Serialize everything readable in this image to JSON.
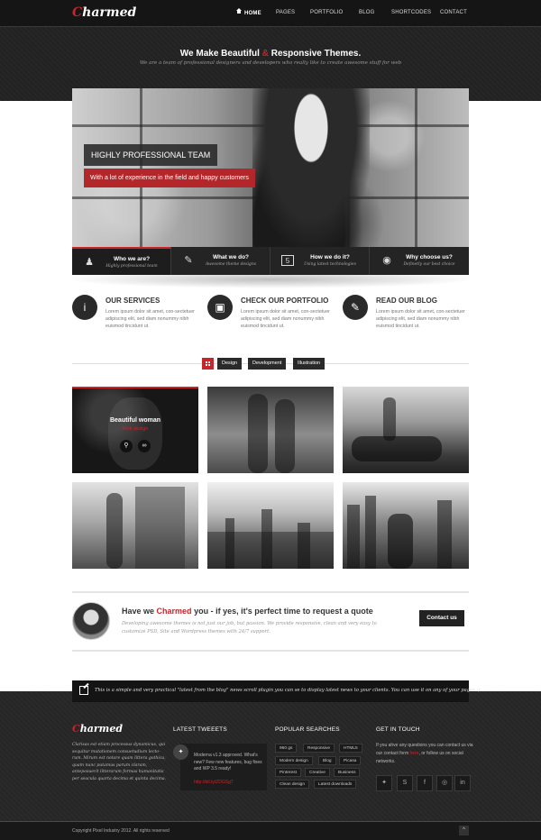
{
  "brand": {
    "logo_first": "C",
    "logo_rest": "harmed",
    "accent": "#c8242b"
  },
  "nav": {
    "items": [
      {
        "label": "HOME",
        "active": true,
        "icon": "home-icon"
      },
      {
        "label": "PAGES"
      },
      {
        "label": "PORTFOLIO"
      },
      {
        "label": "BLOG"
      },
      {
        "label": "SHORTCODES"
      },
      {
        "label": "CONTACT"
      }
    ]
  },
  "intro": {
    "headline_1": "We Make Beautiful",
    "headline_amp": "&",
    "headline_2": "Responsive Themes.",
    "subline": "We are a team of professional designers and developers who really like to create awesome stuff for web"
  },
  "slider": {
    "title": "HIGHLY PROFESSIONAL TEAM",
    "subtitle": "With a lot of experience in the field and happy customers",
    "tabs": [
      {
        "title": "Who we are?",
        "sub": "Highly professional team",
        "icon": "team-icon"
      },
      {
        "title": "What we do?",
        "sub": "Awesome theme designs",
        "icon": "design-icon"
      },
      {
        "title": "How we do it?",
        "sub": "Using latest technologies",
        "icon": "html5-icon"
      },
      {
        "title": "Why choose us?",
        "sub": "Definetly our best choice",
        "icon": "globe-icon"
      }
    ]
  },
  "services": [
    {
      "title": "OUR SERVICES",
      "text": "Lorem ipsum dolor sit amet, con-sectetuer adipiscing elit, sed diam nonummy nibh euismod tincidunt ut.",
      "icon": "info-icon"
    },
    {
      "title": "CHECK OUR PORTFOLIO",
      "text": "Lorem ipsum dolor sit amet, con-sectetuer adipiscing elit, sed diam nonummy nibh euismod tincidunt ut.",
      "icon": "image-icon"
    },
    {
      "title": "READ OUR BLOG",
      "text": "Lorem ipsum dolor sit amet, con-sectetuer adipiscing elit, sed diam nonummy nibh euismod tincidunt ut.",
      "icon": "edit-icon"
    }
  ],
  "filters": [
    "Design",
    "Development",
    "Illustration"
  ],
  "portfolio": {
    "featured_title": "Beautiful woman",
    "featured_category": "Web design"
  },
  "cta": {
    "title_1": "Have we",
    "title_brand": "Charmed",
    "title_2": "you - if yes, it's perfect time to request a quote",
    "text": "Developing awesome themes is not just our job, but passion. We provide responsive, clean and very easy to customize PSD, Site and Wordpress themes with 24/7 support.",
    "button": "Contact us"
  },
  "ticker": "This is a simple and very practical \"latest from the blog\" news scroll plugin you can se to display latest news to your clients. You can use it on any of your pages :)",
  "footer": {
    "about": "Clarisas est etiam processus dynamicus, qui sequitur mutationem consuetudium lecto-rum. Mirum est notare quam littera gothica, quam nunc putamus parum claram, anteposuerit litterarum formas humanitatis per seacula quarta decima et quinta decima.",
    "latest_tweets_heading": "LATEST TWEEETS",
    "tweet": "Moderna v1.3 approved. What's new? Few new features, bug fixes and WP 3.5 ready!",
    "tweet_link": "http://bit.ly/ZDGSg7",
    "popular_heading": "POPULAR SEARCHES",
    "tags": [
      "960 gs",
      "Responsive",
      "HTML5",
      "Modern design",
      "Blog",
      "Picasa",
      "Pinterest",
      "Creative",
      "Business",
      "Clean design",
      "Latest downloads"
    ],
    "contact_heading": "GET IN TOUCH",
    "contact_1": "If you ahve any questions you can contact us via our contact form",
    "contact_link": "here",
    "contact_2": ", or follow us on social networks.",
    "social": [
      "twitter-icon",
      "skype-icon",
      "facebook-icon",
      "dribbble-icon",
      "linkedin-icon"
    ],
    "copyright": "Copyright Pixel Industry 2012. All rights reserved",
    "back_to_top": "^"
  }
}
